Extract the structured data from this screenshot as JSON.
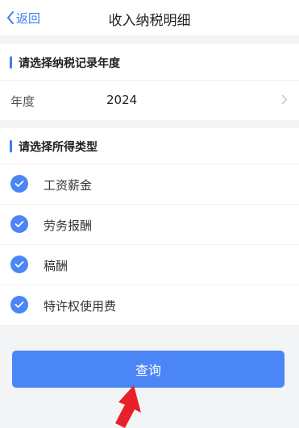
{
  "nav": {
    "back_label": "返回",
    "title": "收入纳税明细"
  },
  "year_section": {
    "title": "请选择纳税记录年度",
    "row_label": "年度",
    "row_value": "2024"
  },
  "type_section": {
    "title": "请选择所得类型",
    "items": [
      {
        "label": "工资薪金",
        "checked": true
      },
      {
        "label": "劳务报酬",
        "checked": true
      },
      {
        "label": "稿酬",
        "checked": true
      },
      {
        "label": "特许权使用费",
        "checked": true
      }
    ]
  },
  "query_button": {
    "label": "查询"
  },
  "colors": {
    "accent": "#3d7cf6",
    "button": "#4a86f5",
    "annotation_arrow": "#e8202a",
    "background": "#f3f4f6"
  }
}
